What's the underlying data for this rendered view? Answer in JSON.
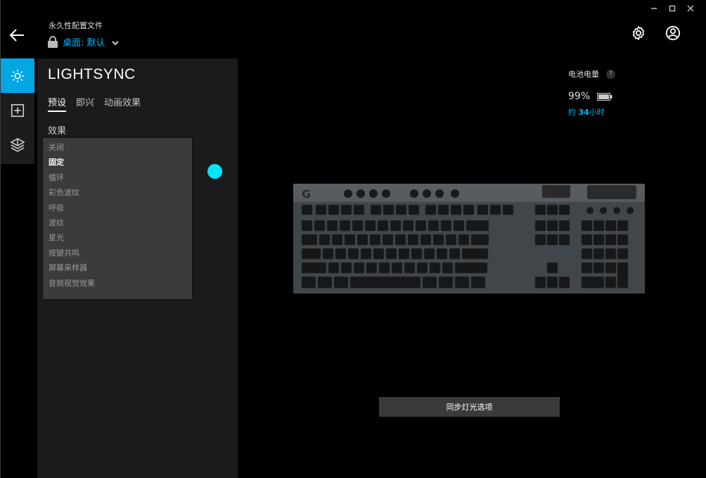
{
  "window": {
    "controls": [
      "minimize-icon",
      "maximize-icon",
      "close-icon"
    ]
  },
  "header": {
    "profile_label": "永久性配置文件",
    "profile_name": "桌面: 默认"
  },
  "sidebar": {
    "items": [
      {
        "icon": "lightsync-icon",
        "active": true
      },
      {
        "icon": "add-icon",
        "active": false
      },
      {
        "icon": "assign-icon",
        "active": false
      }
    ]
  },
  "panel": {
    "title": "LIGHTSYNC",
    "tabs": [
      "预设",
      "即兴",
      "动画效果"
    ],
    "active_tab": "预设",
    "effect_label": "效果",
    "effects": [
      "关闭",
      "固定",
      "循环",
      "彩色波纹",
      "呼吸",
      "波纹",
      "星光",
      "按键共鸣",
      "屏幕采样器",
      "音频视觉效果"
    ],
    "selected_effect": "固定",
    "color": "#00e6ff"
  },
  "battery": {
    "label": "电池电量",
    "help": "?",
    "percent": "99%",
    "time_prefix": "约 ",
    "time_value": "34",
    "time_suffix": "小时"
  },
  "sync_button": "同步灯光选项",
  "colors": {
    "accent": "#00b8fc",
    "active_rail": "#00a7e3",
    "panel_bg": "#1b1b1b"
  }
}
